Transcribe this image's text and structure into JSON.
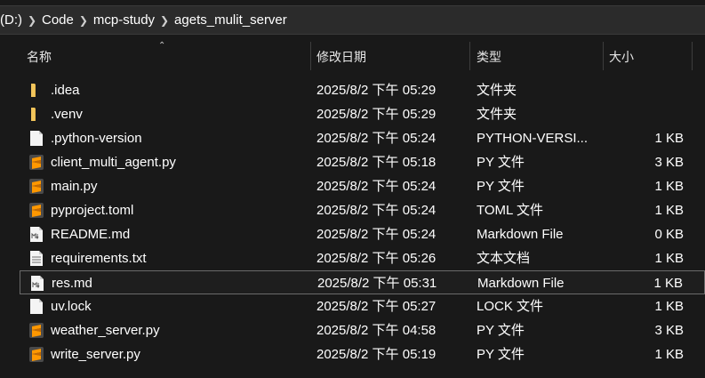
{
  "breadcrumb": [
    "(D:)",
    "Code",
    "mcp-study",
    "agets_mulit_server"
  ],
  "columns": {
    "name": "名称",
    "date": "修改日期",
    "type": "类型",
    "size": "大小"
  },
  "files": [
    {
      "name": ".idea",
      "date": "2025/8/2 下午 05:29",
      "type": "文件夹",
      "size": "",
      "icon": "folder-icon"
    },
    {
      "name": ".venv",
      "date": "2025/8/2 下午 05:29",
      "type": "文件夹",
      "size": "",
      "icon": "folder-icon"
    },
    {
      "name": ".python-version",
      "date": "2025/8/2 下午 05:24",
      "type": "PYTHON-VERSI...",
      "size": "1 KB",
      "icon": "blank-file-icon"
    },
    {
      "name": "client_multi_agent.py",
      "date": "2025/8/2 下午 05:18",
      "type": "PY 文件",
      "size": "3 KB",
      "icon": "sublime-file-icon"
    },
    {
      "name": "main.py",
      "date": "2025/8/2 下午 05:24",
      "type": "PY 文件",
      "size": "1 KB",
      "icon": "sublime-file-icon"
    },
    {
      "name": "pyproject.toml",
      "date": "2025/8/2 下午 05:24",
      "type": "TOML 文件",
      "size": "1 KB",
      "icon": "sublime-file-icon"
    },
    {
      "name": "README.md",
      "date": "2025/8/2 下午 05:24",
      "type": "Markdown File",
      "size": "0 KB",
      "icon": "markdown-file-icon"
    },
    {
      "name": "requirements.txt",
      "date": "2025/8/2 下午 05:26",
      "type": "文本文档",
      "size": "1 KB",
      "icon": "text-file-icon"
    },
    {
      "name": "res.md",
      "date": "2025/8/2 下午 05:31",
      "type": "Markdown File",
      "size": "1 KB",
      "icon": "markdown-file-icon",
      "selected": true
    },
    {
      "name": "uv.lock",
      "date": "2025/8/2 下午 05:27",
      "type": "LOCK 文件",
      "size": "1 KB",
      "icon": "blank-file-icon"
    },
    {
      "name": "weather_server.py",
      "date": "2025/8/2 下午 04:58",
      "type": "PY 文件",
      "size": "3 KB",
      "icon": "sublime-file-icon"
    },
    {
      "name": "write_server.py",
      "date": "2025/8/2 下午 05:19",
      "type": "PY 文件",
      "size": "1 KB",
      "icon": "sublime-file-icon"
    }
  ],
  "colors": {
    "background": "#191919",
    "folder": "#e8b84a",
    "sublime": "#ff9800",
    "selection_border": "#6b6b6b"
  }
}
